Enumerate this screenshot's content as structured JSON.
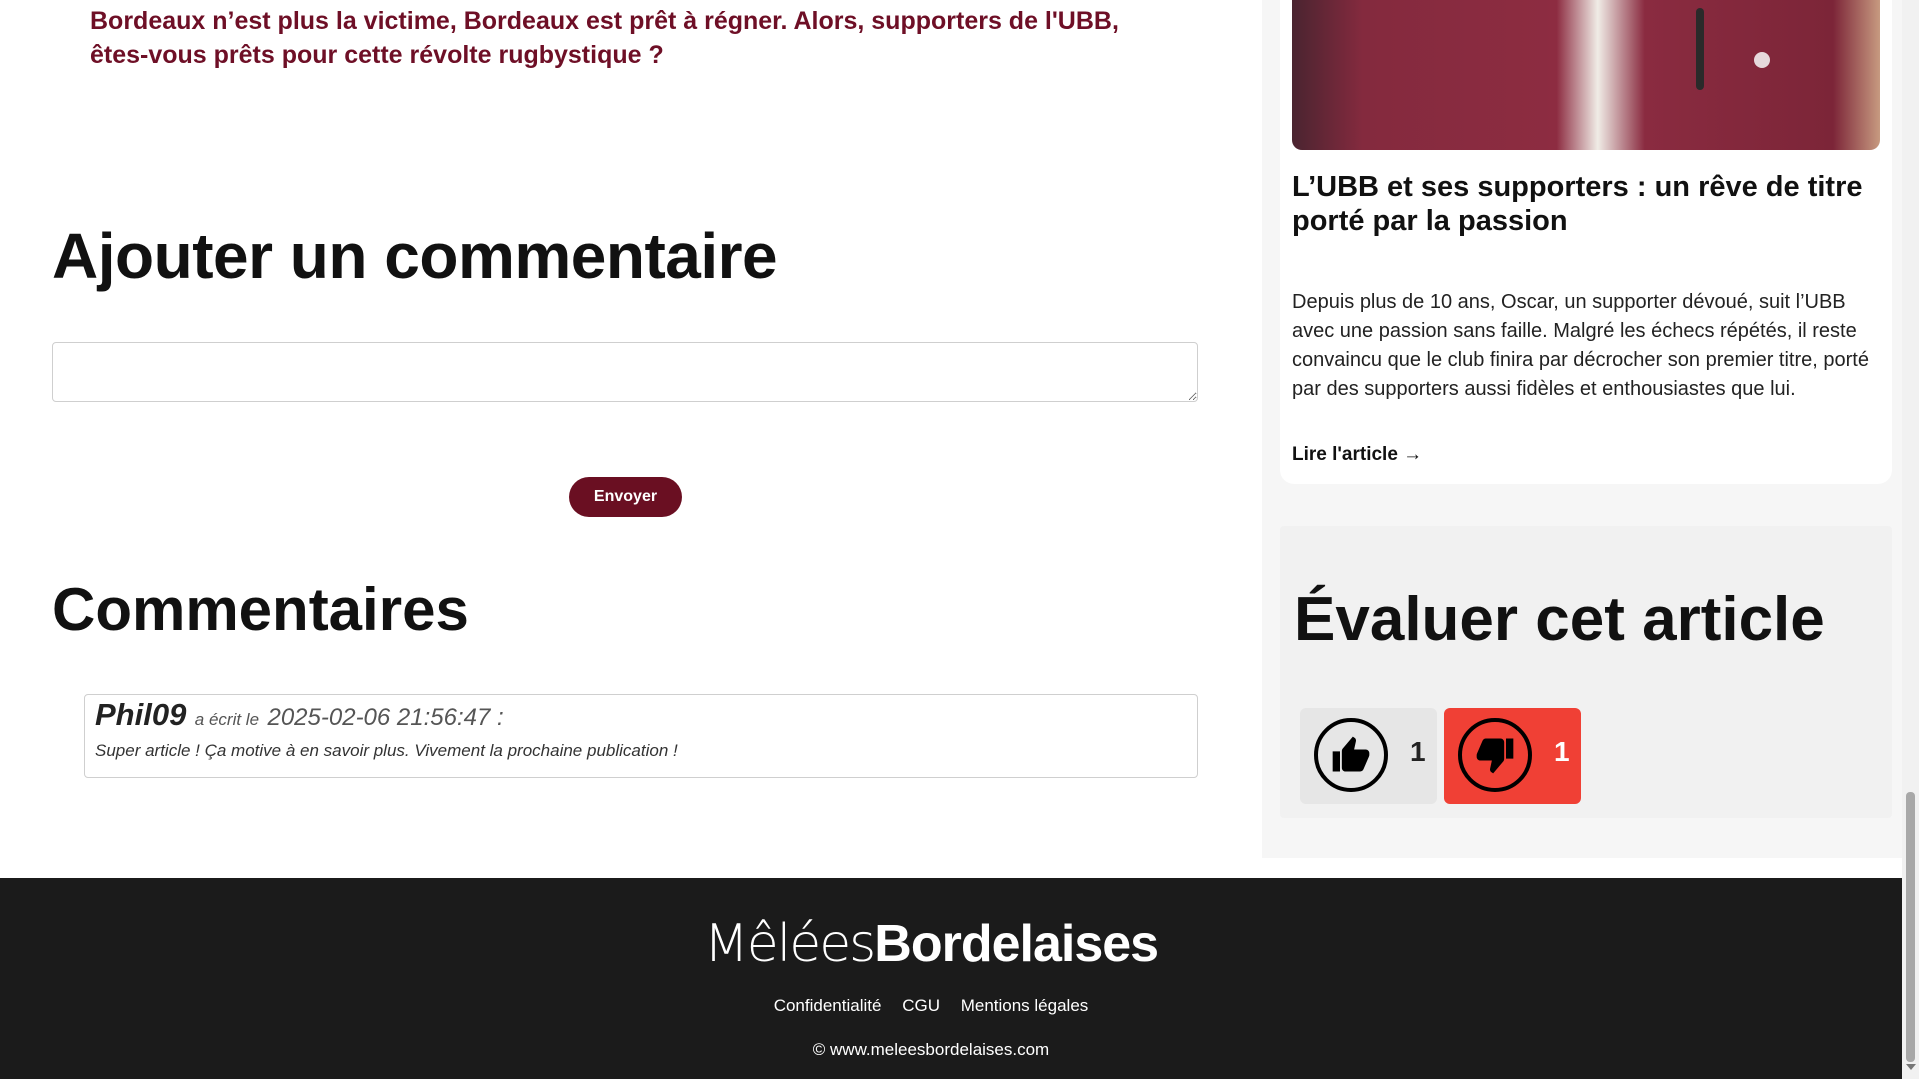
{
  "article": {
    "intro_lines": "Bordeaux n’est plus la victime, Bordeaux est prêt à régner. Alors, supporters de l'UBB, êtes-vous prêts pour cette révolte rugbystique ?"
  },
  "comment_form": {
    "title": "Ajouter un commentaire",
    "input_value": "",
    "submit_label": "Envoyer"
  },
  "comments": {
    "title": "Commentaires",
    "items": [
      {
        "author": "Phil09",
        "wrote_label": "a écrit le",
        "date": "2025-02-06 21:56:47 :",
        "text": "Super article ! Ça motive à en savoir plus. Vivement la prochaine publication !"
      }
    ]
  },
  "sidebar": {
    "card": {
      "image_icon": "supporters-photo",
      "title": "L’UBB et ses supporters : un rêve de titre porté par la passion",
      "text": "Depuis plus de 10 ans, Oscar, un supporter dévoué, suit l’UBB avec une passion sans faille. Malgré les échecs répétés, il reste convaincu que le club finira par décrocher son premier titre, porté par des supporters aussi fidèles et enthousiastes que lui.",
      "link_label": "Lire l'article →"
    },
    "rating": {
      "title": "Évaluer cet article",
      "up_icon": "thumbs-up-icon",
      "up_count": "1",
      "down_icon": "thumbs-down-icon",
      "down_count": "1",
      "down_color": "#f04035"
    }
  },
  "footer": {
    "logo_light": "Mêlées",
    "logo_bold": "Bordelaises",
    "links": [
      "Confidentialité",
      "CGU",
      "Mentions légales"
    ],
    "copyright": "© www.meleesbordelaises.com"
  },
  "colors": {
    "accent": "#6a0f22",
    "intro_text": "#6e0f26",
    "footer_bg": "#1b1b1b"
  }
}
